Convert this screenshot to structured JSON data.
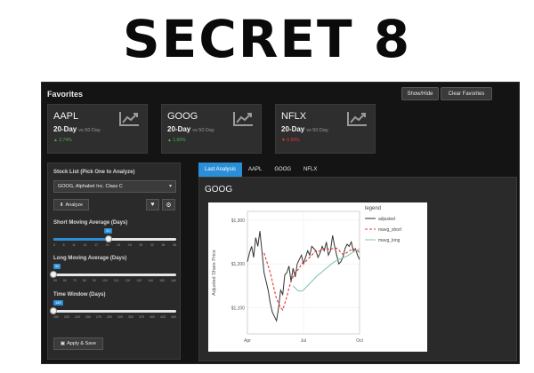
{
  "banner": {
    "text": "SECRET 8"
  },
  "favorites": {
    "title": "Favorites",
    "show_hide_label": "Show/Hide",
    "clear_label": "Clear Favorites",
    "cards": [
      {
        "symbol": "AAPL",
        "period": "20-Day",
        "vs": "vs 50 Day",
        "pct": "▲ 2.74%",
        "direction": "up",
        "icon": "line-chart-icon"
      },
      {
        "symbol": "GOOG",
        "period": "20-Day",
        "vs": "vs 50 Day",
        "pct": "▲ 1.66%",
        "direction": "up",
        "icon": "line-chart-icon"
      },
      {
        "symbol": "NFLX",
        "period": "20-Day",
        "vs": "vs 50 Day",
        "pct": "▼ 0.69%",
        "direction": "down",
        "icon": "line-chart-icon"
      }
    ]
  },
  "sidebar": {
    "stock_list_label": "Stock List (Pick One to Analyze)",
    "selected_stock": "GOOG, Alphabet Inc. Class C",
    "analyze_label": "Analyze",
    "short_ma": {
      "label": "Short Moving Average (Days)",
      "value": "20",
      "fraction": 0.45,
      "ticks": [
        "5",
        "8",
        "11",
        "14",
        "17",
        "20",
        "23",
        "26",
        "29",
        "32",
        "35",
        "38"
      ]
    },
    "long_ma": {
      "label": "Long Moving Average (Days)",
      "value": "50",
      "fraction": 0.0,
      "ticks": [
        "50",
        "60",
        "70",
        "80",
        "90",
        "100",
        "110",
        "120",
        "130",
        "140",
        "150",
        "160"
      ]
    },
    "time_window": {
      "label": "Time Window (Days)",
      "value": "180",
      "fraction": 0.0,
      "ticks": [
        "180",
        "200",
        "225",
        "250",
        "275",
        "300",
        "325",
        "350",
        "375",
        "400",
        "425",
        "450"
      ]
    },
    "apply_label": "Apply & Save"
  },
  "tabs": [
    "Last Analysis",
    "AAPL",
    "GOOG",
    "NFLX"
  ],
  "main": {
    "title": "GOOG"
  },
  "colors": {
    "accent": "#2a8fd8",
    "up": "#4caf50",
    "down": "#e53935"
  },
  "chart_data": {
    "type": "line",
    "title": "",
    "xlabel": "",
    "ylabel": "Adjusted Share Price",
    "x_ticks": [
      "Apr",
      "Jul",
      "Oct"
    ],
    "y_ticks": [
      "$1,100",
      "$1,200",
      "$1,300"
    ],
    "ylim": [
      1040,
      1320
    ],
    "legend_title": "legend",
    "legend_position": "right",
    "series": [
      {
        "name": "adjusted",
        "color": "#333333",
        "dash": "solid",
        "values": [
          1205,
          1225,
          1240,
          1215,
          1260,
          1240,
          1275,
          1230,
          1180,
          1160,
          1140,
          1110,
          1090,
          1080,
          1070,
          1100,
          1140,
          1130,
          1175,
          1180,
          1195,
          1160,
          1190,
          1170,
          1200,
          1210,
          1220,
          1200,
          1215,
          1230,
          1220,
          1240,
          1235,
          1230,
          1215,
          1225,
          1240,
          1230,
          1250,
          1220,
          1230,
          1265,
          1240,
          1220,
          1200,
          1205,
          1215,
          1235,
          1245,
          1240,
          1250,
          1230,
          1235,
          1220,
          1210
        ]
      },
      {
        "name": "mavg_short",
        "color": "#e53935",
        "dash": "dashed",
        "values": [
          null,
          null,
          null,
          null,
          null,
          null,
          null,
          null,
          1225,
          1210,
          1195,
          1180,
          1160,
          1140,
          1120,
          1110,
          1100,
          1095,
          1110,
          1125,
          1145,
          1160,
          1170,
          1180,
          1185,
          1190,
          1200,
          1205,
          1205,
          1210,
          1215,
          1220,
          1225,
          1230,
          1228,
          1230,
          1232,
          1235,
          1235,
          1234,
          1233,
          1235,
          1236,
          1236,
          1232,
          1225,
          1222,
          1223,
          1226,
          1230,
          1232,
          1233,
          1234,
          1230,
          1226
        ]
      },
      {
        "name": "mavg_long",
        "color": "#7fc8a9",
        "dash": "solid",
        "values": [
          null,
          null,
          null,
          null,
          null,
          null,
          null,
          null,
          null,
          null,
          null,
          null,
          null,
          null,
          null,
          null,
          null,
          null,
          null,
          null,
          null,
          null,
          1150,
          1145,
          1140,
          1138,
          1138,
          1140,
          1145,
          1150,
          1155,
          1160,
          1165,
          1170,
          1175,
          1178,
          1182,
          1186,
          1190,
          1194,
          1198,
          1202,
          1205,
          1208,
          1210,
          1212,
          1214,
          1216,
          1218,
          1221,
          1224,
          1227,
          1230,
          1232,
          1234
        ]
      }
    ]
  }
}
